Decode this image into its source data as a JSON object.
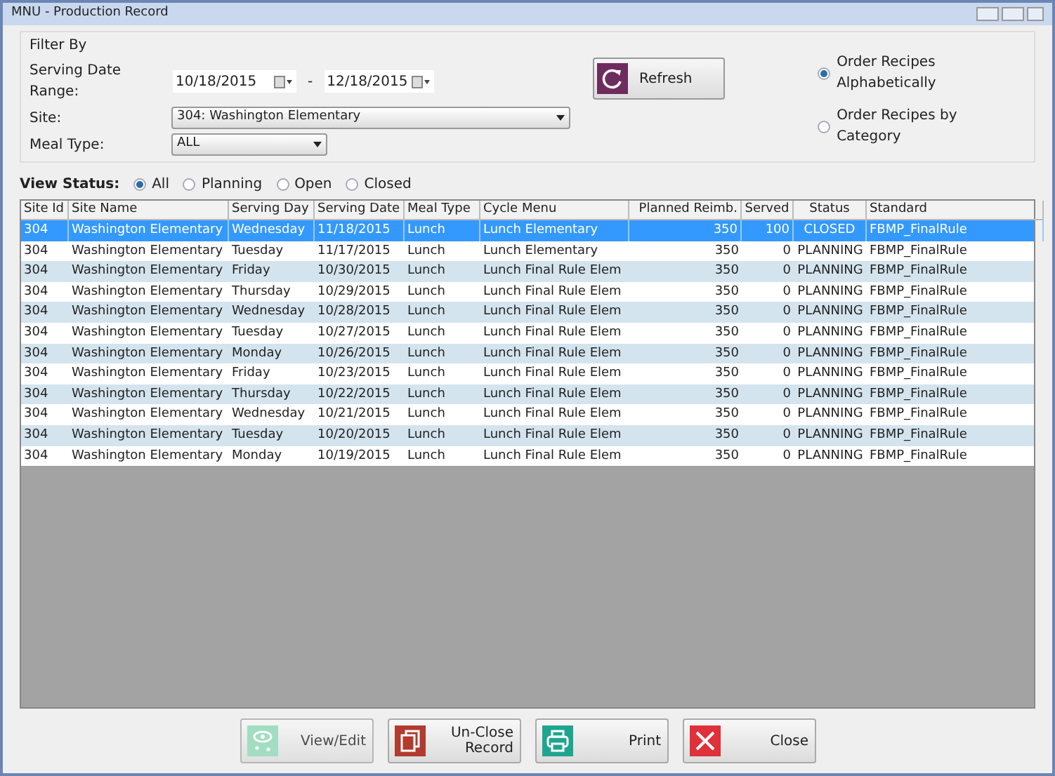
{
  "window": {
    "title": "MNU - Production Record"
  },
  "filter": {
    "title": "Filter By",
    "date_range_label": "Serving Date Range:",
    "date_from": "10/18/2015",
    "date_separator": "-",
    "date_to": "12/18/2015",
    "site_label": "Site:",
    "site_value": "304:  Washington Elementary",
    "meal_type_label": "Meal Type:",
    "meal_type_value": "ALL",
    "refresh": "Refresh",
    "order_options": [
      {
        "label": "Order Recipes Alphabetically",
        "selected": true
      },
      {
        "label": "Order Recipes by Category",
        "selected": false
      }
    ]
  },
  "view_status": {
    "label": "View Status:",
    "options": [
      {
        "label": "All",
        "selected": true
      },
      {
        "label": "Planning",
        "selected": false
      },
      {
        "label": "Open",
        "selected": false
      },
      {
        "label": "Closed",
        "selected": false
      }
    ]
  },
  "table": {
    "columns": [
      "Site Id",
      "Site Name",
      "Serving Day",
      "Serving Date",
      "Meal Type",
      "Cycle Menu",
      "Planned Reimb.",
      "Served",
      "Status",
      "Standard"
    ],
    "rows": [
      {
        "selected": true,
        "cells": [
          "304",
          "Washington Elementary",
          "Wednesday",
          "11/18/2015",
          "Lunch",
          "Lunch Elementary",
          "350",
          "100",
          "CLOSED",
          "FBMP_FinalRule"
        ]
      },
      {
        "selected": false,
        "cells": [
          "304",
          "Washington Elementary",
          "Tuesday",
          "11/17/2015",
          "Lunch",
          "Lunch Elementary",
          "350",
          "0",
          "PLANNING",
          "FBMP_FinalRule"
        ]
      },
      {
        "selected": false,
        "cells": [
          "304",
          "Washington Elementary",
          "Friday",
          "10/30/2015",
          "Lunch",
          "Lunch Final Rule Elem",
          "350",
          "0",
          "PLANNING",
          "FBMP_FinalRule"
        ]
      },
      {
        "selected": false,
        "cells": [
          "304",
          "Washington Elementary",
          "Thursday",
          "10/29/2015",
          "Lunch",
          "Lunch Final Rule Elem",
          "350",
          "0",
          "PLANNING",
          "FBMP_FinalRule"
        ]
      },
      {
        "selected": false,
        "cells": [
          "304",
          "Washington Elementary",
          "Wednesday",
          "10/28/2015",
          "Lunch",
          "Lunch Final Rule Elem",
          "350",
          "0",
          "PLANNING",
          "FBMP_FinalRule"
        ]
      },
      {
        "selected": false,
        "cells": [
          "304",
          "Washington Elementary",
          "Tuesday",
          "10/27/2015",
          "Lunch",
          "Lunch Final Rule Elem",
          "350",
          "0",
          "PLANNING",
          "FBMP_FinalRule"
        ]
      },
      {
        "selected": false,
        "cells": [
          "304",
          "Washington Elementary",
          "Monday",
          "10/26/2015",
          "Lunch",
          "Lunch Final Rule Elem",
          "350",
          "0",
          "PLANNING",
          "FBMP_FinalRule"
        ]
      },
      {
        "selected": false,
        "cells": [
          "304",
          "Washington Elementary",
          "Friday",
          "10/23/2015",
          "Lunch",
          "Lunch Final Rule Elem",
          "350",
          "0",
          "PLANNING",
          "FBMP_FinalRule"
        ]
      },
      {
        "selected": false,
        "cells": [
          "304",
          "Washington Elementary",
          "Thursday",
          "10/22/2015",
          "Lunch",
          "Lunch Final Rule Elem",
          "350",
          "0",
          "PLANNING",
          "FBMP_FinalRule"
        ]
      },
      {
        "selected": false,
        "cells": [
          "304",
          "Washington Elementary",
          "Wednesday",
          "10/21/2015",
          "Lunch",
          "Lunch Final Rule Elem",
          "350",
          "0",
          "PLANNING",
          "FBMP_FinalRule"
        ]
      },
      {
        "selected": false,
        "cells": [
          "304",
          "Washington Elementary",
          "Tuesday",
          "10/20/2015",
          "Lunch",
          "Lunch Final Rule Elem",
          "350",
          "0",
          "PLANNING",
          "FBMP_FinalRule"
        ]
      },
      {
        "selected": false,
        "cells": [
          "304",
          "Washington Elementary",
          "Monday",
          "10/19/2015",
          "Lunch",
          "Lunch Final Rule Elem",
          "350",
          "0",
          "PLANNING",
          "FBMP_FinalRule"
        ]
      }
    ]
  },
  "buttons": [
    {
      "kind": "view",
      "label": "View/Edit",
      "disabled": true
    },
    {
      "kind": "unclose",
      "label": "Un-Close Record",
      "disabled": false
    },
    {
      "kind": "print",
      "label": "Print",
      "disabled": false
    },
    {
      "kind": "close",
      "label": "Close",
      "disabled": false
    }
  ]
}
